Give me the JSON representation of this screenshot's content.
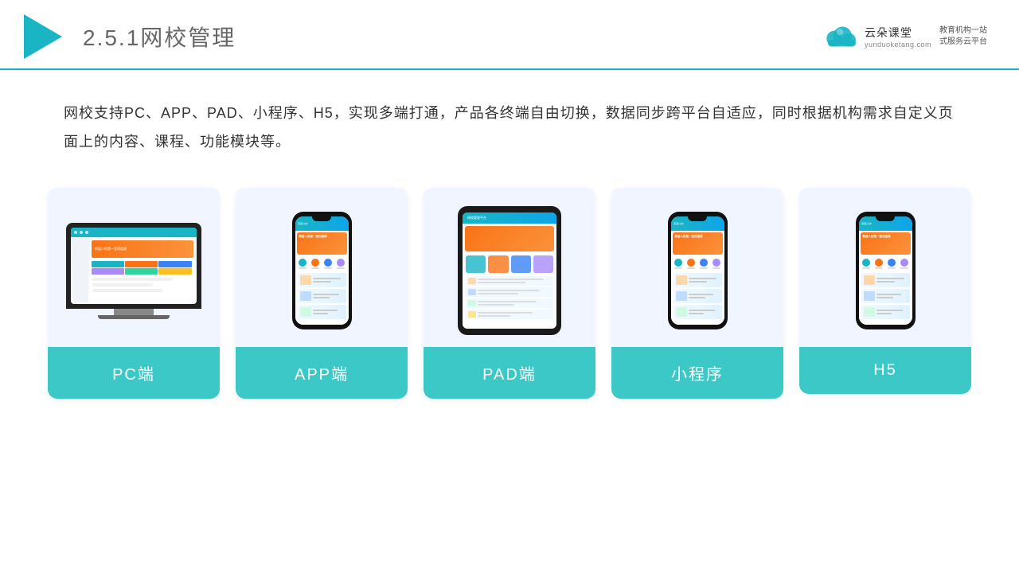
{
  "header": {
    "title_prefix": "2.5.1",
    "title_main": "网校管理",
    "logo_name": "云朵课堂",
    "logo_sub": "yunduoketang.com",
    "logo_tagline_line1": "教育机构一站",
    "logo_tagline_line2": "式服务云平台"
  },
  "description": {
    "text": "网校支持PC、APP、PAD、小程序、H5，实现多端打通，产品各终端自由切换，数据同步跨平台自适应，同时根据机构需求自定义页面上的内容、课程、功能模块等。"
  },
  "cards": [
    {
      "id": "pc",
      "label": "PC端"
    },
    {
      "id": "app",
      "label": "APP端"
    },
    {
      "id": "pad",
      "label": "PAD端"
    },
    {
      "id": "miniprogram",
      "label": "小程序"
    },
    {
      "id": "h5",
      "label": "H5"
    }
  ],
  "colors": {
    "teal": "#3dc8c8",
    "orange": "#f97316",
    "blue": "#3b82f6",
    "dark": "#222222"
  }
}
